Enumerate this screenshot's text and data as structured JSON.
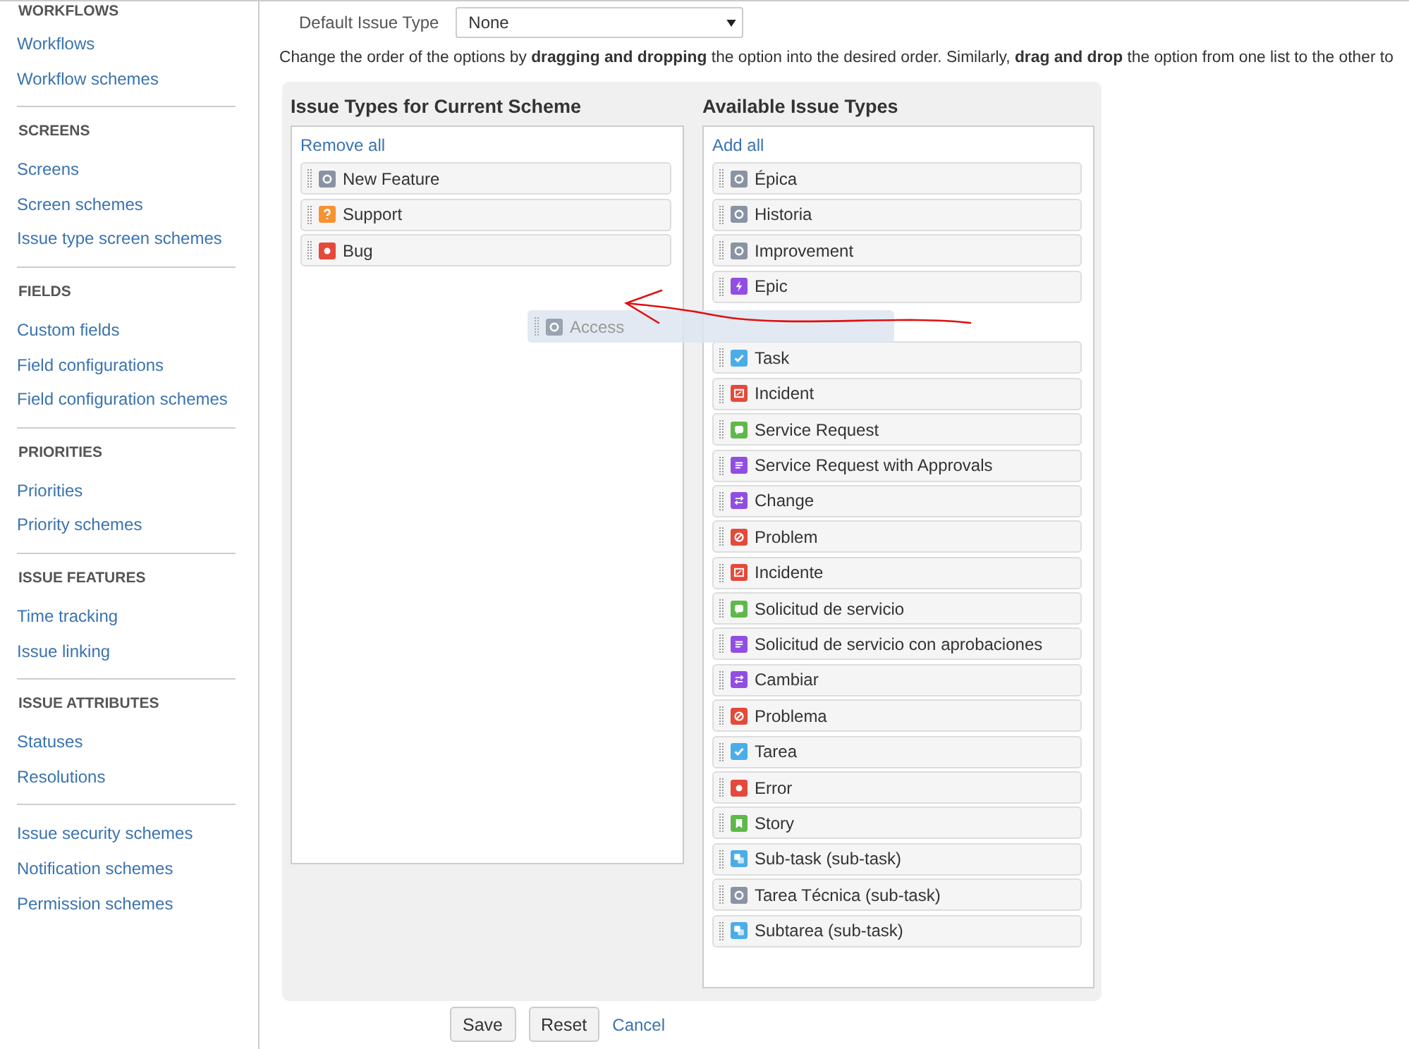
{
  "sidebar": {
    "sections": [
      {
        "heading": "WORKFLOWS",
        "items": [
          "Workflows",
          "Workflow schemes"
        ]
      },
      {
        "heading": "SCREENS",
        "items": [
          "Screens",
          "Screen schemes",
          "Issue type screen schemes"
        ]
      },
      {
        "heading": "FIELDS",
        "items": [
          "Custom fields",
          "Field configurations",
          "Field configuration schemes"
        ]
      },
      {
        "heading": "PRIORITIES",
        "items": [
          "Priorities",
          "Priority schemes"
        ]
      },
      {
        "heading": "ISSUE FEATURES",
        "items": [
          "Time tracking",
          "Issue linking"
        ]
      },
      {
        "heading": "ISSUE ATTRIBUTES",
        "items": [
          "Statuses",
          "Resolutions"
        ]
      },
      {
        "items": [
          "Issue security schemes",
          "Notification schemes",
          "Permission schemes"
        ]
      }
    ]
  },
  "default_issue_type": {
    "label": "Default Issue Type",
    "value": "None"
  },
  "instructions": "Change the order of the options by **dragging and dropping** the option into the desired order. Similarly, **drag and drop** the option from one list to the other to",
  "current_scheme": {
    "title": "Issue Types for Current Scheme",
    "action": "Remove all",
    "items": [
      {
        "label": "New Feature",
        "kind": "generic"
      },
      {
        "label": "Support",
        "kind": "question"
      },
      {
        "label": "Bug",
        "kind": "bug"
      }
    ]
  },
  "available": {
    "title": "Available Issue Types",
    "action": "Add all",
    "items": [
      {
        "label": "Épica",
        "kind": "generic"
      },
      {
        "label": "Historia",
        "kind": "generic"
      },
      {
        "label": "Improvement",
        "kind": "generic"
      },
      {
        "label": "Epic",
        "kind": "epic"
      },
      {
        "kind": "drop-slot"
      },
      {
        "label": "Task",
        "kind": "task"
      },
      {
        "label": "Incident",
        "kind": "incident"
      },
      {
        "label": "Service Request",
        "kind": "service"
      },
      {
        "label": "Service Request with Approvals",
        "kind": "approval"
      },
      {
        "label": "Change",
        "kind": "change"
      },
      {
        "label": "Problem",
        "kind": "problem"
      },
      {
        "label": "Incidente",
        "kind": "incident"
      },
      {
        "label": "Solicitud de servicio",
        "kind": "service"
      },
      {
        "label": "Solicitud de servicio con aprobaciones",
        "kind": "approval"
      },
      {
        "label": "Cambiar",
        "kind": "change"
      },
      {
        "label": "Problema",
        "kind": "problem"
      },
      {
        "label": "Tarea",
        "kind": "task"
      },
      {
        "label": "Error",
        "kind": "bug"
      },
      {
        "label": "Story",
        "kind": "story"
      },
      {
        "label": "Sub-task (sub-task)",
        "kind": "subtask"
      },
      {
        "label": "Tarea Técnica (sub-task)",
        "kind": "generic"
      },
      {
        "label": "Subtarea (sub-task)",
        "kind": "subtask"
      }
    ]
  },
  "dragged_item": {
    "label": "Access",
    "kind": "generic"
  },
  "buttons": [
    {
      "label": "Save",
      "kind": "button"
    },
    {
      "label": "Reset",
      "kind": "button"
    },
    {
      "label": "Cancel",
      "kind": "link"
    }
  ]
}
